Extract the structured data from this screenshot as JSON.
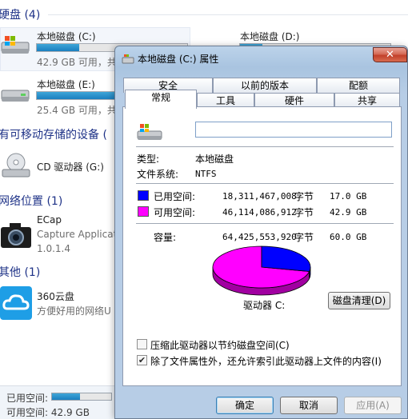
{
  "explorer": {
    "groups": {
      "hard_disks": "硬盘 (4)",
      "removable": "有可移动存储的设备 (",
      "network": "网络位置 (1)",
      "other": "其他 (1)"
    },
    "drives": [
      {
        "name": "本地磁盘 (C:)",
        "free": "42.9 GB 可用，共",
        "used_fraction": 0.28
      },
      {
        "name": "本地磁盘 (D:)",
        "free": "",
        "used_fraction": 0.15
      },
      {
        "name": "本地磁盘 (E:)",
        "free": "25.4 GB 可用，共",
        "used_fraction": 0.7
      }
    ],
    "cd_drive": "CD 驱动器 (G:)",
    "network_item": {
      "name": "ECap",
      "desc": "Capture Applicat",
      "version": "1.0.1.4"
    },
    "other_item": {
      "name": "360云盘",
      "desc": "方便好用的网络U"
    },
    "status": {
      "used_label": "已用空间:",
      "free_line": "可用空间: 42.9 GB",
      "used_fraction": 0.47
    }
  },
  "dialog": {
    "title": "本地磁盘 (C:) 属性",
    "close_label": "✕",
    "tabs_row1": [
      "安全",
      "以前的版本",
      "配额"
    ],
    "tabs_row2": [
      "常规",
      "工具",
      "硬件",
      "共享"
    ],
    "active_tab": "常规",
    "volume_label_value": "",
    "type_label": "类型:",
    "type_value": "本地磁盘",
    "fs_label": "文件系统:",
    "fs_value": "NTFS",
    "used": {
      "label": "已用空间:",
      "bytes": "18,311,467,008",
      "unit": "字节",
      "size": "17.0 GB",
      "color": "#0000ff"
    },
    "free": {
      "label": "可用空间:",
      "bytes": "46,114,086,912",
      "unit": "字节",
      "size": "42.9 GB",
      "color": "#ff00ff"
    },
    "capacity": {
      "label": "容量:",
      "bytes": "64,425,553,920",
      "unit": "字节",
      "size": "60.0 GB"
    },
    "used_fraction": 0.284,
    "drive_label": "驱动器 C:",
    "cleanup_button": "磁盘清理(D)",
    "compress_checkbox": {
      "label": "压缩此驱动器以节约磁盘空间(C)",
      "checked": false
    },
    "index_checkbox": {
      "label": "除了文件属性外，还允许索引此驱动器上文件的内容(I)",
      "checked": true
    },
    "ok_button": "确定",
    "cancel_button": "取消",
    "apply_button": "应用(A)"
  }
}
